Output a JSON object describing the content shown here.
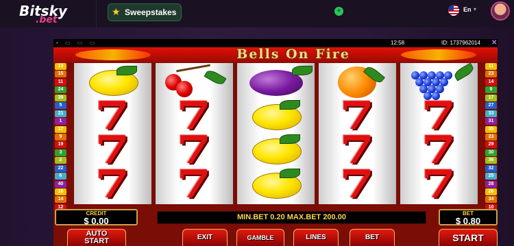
{
  "site": {
    "logo_main": "Bitsky",
    "logo_sub": ".bet",
    "sweepstakes_label": "Sweepstakes",
    "lang": "En",
    "icons": {
      "star": "star-icon",
      "plus": "plus-icon",
      "flag": "us-flag-icon",
      "chevron": "chevron-down-icon"
    }
  },
  "game": {
    "time": "12:58",
    "id_text": "ID: 1737962014",
    "title": "Bells On Fire",
    "left_numbers": [
      "13",
      "15",
      "11",
      "24",
      "39",
      "5",
      "21",
      "1",
      "17",
      "9",
      "19",
      "3",
      "2",
      "22",
      "6",
      "40",
      "16",
      "14",
      "12"
    ],
    "right_numbers": [
      "11",
      "23",
      "14",
      "9",
      "17",
      "27",
      "33",
      "31",
      "35",
      "23",
      "29",
      "30",
      "36",
      "32",
      "25",
      "28",
      "26",
      "34",
      "10"
    ],
    "reels": [
      [
        "lemon",
        "seven",
        "seven",
        "seven"
      ],
      [
        "cherries",
        "seven",
        "seven",
        "seven"
      ],
      [
        "plum",
        "lemon",
        "lemon",
        "lemon"
      ],
      [
        "orange",
        "seven",
        "seven",
        "seven"
      ],
      [
        "grapes",
        "seven",
        "seven",
        "seven"
      ]
    ],
    "credit_label": "CREDIT",
    "credit_value": "$ 0.00",
    "message": "MIN.BET 0.20 MAX.BET 200.00",
    "bet_label": "BET",
    "bet_value": "$ 0.80",
    "buttons": {
      "auto_start_1": "AUTO",
      "auto_start_2": "START",
      "exit": "EXIT",
      "gamble": "GAMBLE",
      "lines": "LINES",
      "bet": "BET",
      "start": "START"
    }
  },
  "colors": {
    "badge_palette": [
      "#f0c000",
      "#e07000",
      "#d01010",
      "#30a030",
      "#a0c020",
      "#2060d0",
      "#40b0d0",
      "#9020a0"
    ]
  }
}
